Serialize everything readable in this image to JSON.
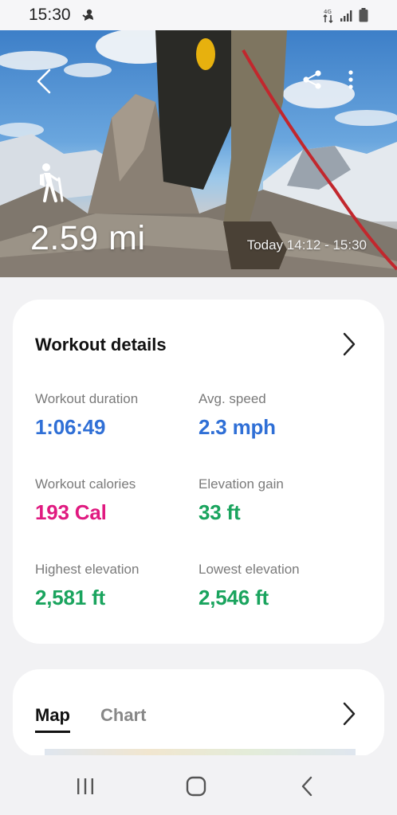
{
  "status_bar": {
    "time": "15:30",
    "icons": [
      "notification-icon",
      "data-arrows-icon",
      "signal-icon",
      "battery-icon"
    ]
  },
  "hero": {
    "back_icon": "chevron-left-icon",
    "share_icon": "share-icon",
    "more_icon": "more-vert-icon",
    "activity_icon": "hiking-icon",
    "distance": "2.59 mi",
    "time_range": "Today 14:12 - 15:30"
  },
  "details": {
    "title": "Workout details",
    "stats": [
      {
        "label": "Workout duration",
        "value": "1:06:49",
        "color": "#2f6fd6"
      },
      {
        "label": "Avg. speed",
        "value": "2.3 mph",
        "color": "#2f6fd6"
      },
      {
        "label": "Workout calories",
        "value": "193 Cal",
        "color": "#e01a80"
      },
      {
        "label": "Elevation gain",
        "value": "33 ft",
        "color": "#1aa45e"
      },
      {
        "label": "Highest elevation",
        "value": "2,581 ft",
        "color": "#1aa45e"
      },
      {
        "label": "Lowest elevation",
        "value": "2,546 ft",
        "color": "#1aa45e"
      }
    ]
  },
  "map_card": {
    "tabs": [
      {
        "label": "Map",
        "selected": true
      },
      {
        "label": "Chart",
        "selected": false
      }
    ]
  },
  "nav": {
    "recents_icon": "recents-icon",
    "home_icon": "home-icon",
    "back_icon": "back-icon"
  }
}
